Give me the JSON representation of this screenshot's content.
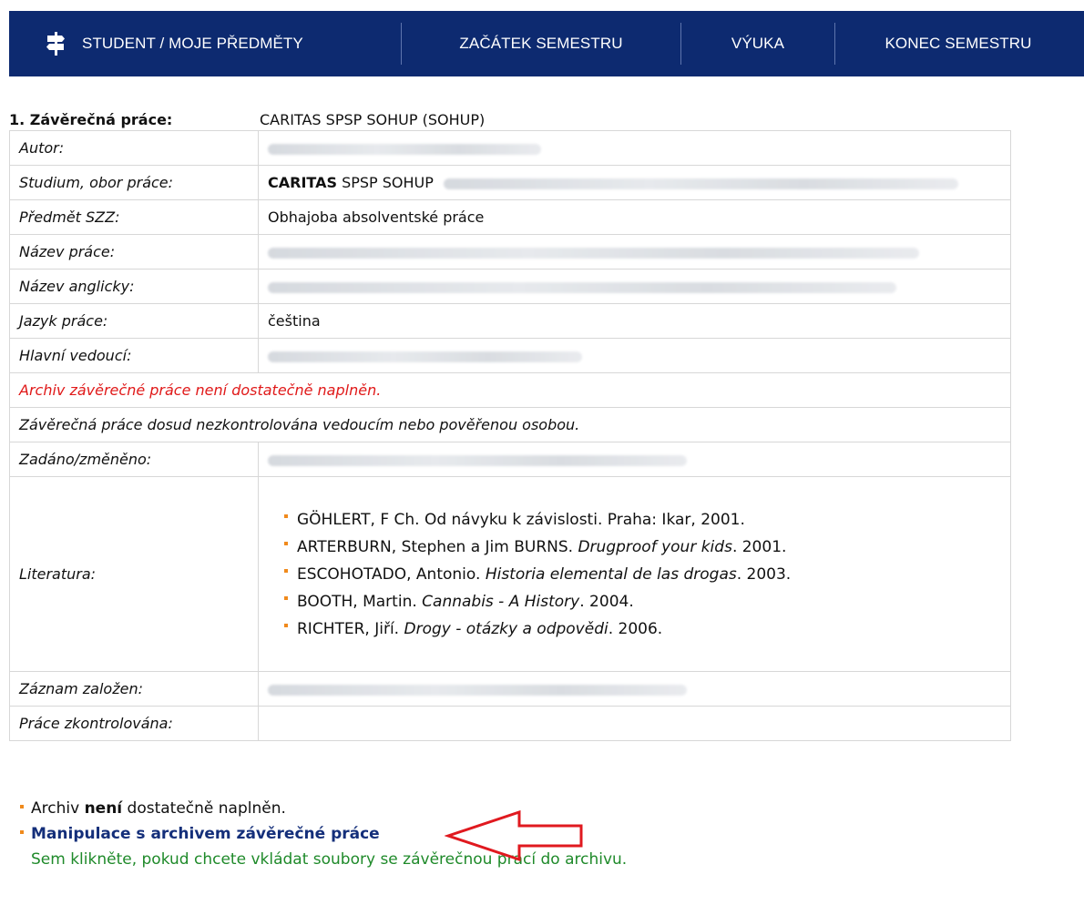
{
  "nav": {
    "items": [
      {
        "label": "STUDENT / MOJE PŘEDMĚTY",
        "icon": "signpost-icon"
      },
      {
        "label": "ZAČÁTEK SEMESTRU"
      },
      {
        "label": "VÝUKA"
      },
      {
        "label": "KONEC SEMESTRU"
      }
    ],
    "bg_color": "#0d2a70"
  },
  "thesis": {
    "number_label": "1. Závěrečná práce:",
    "program": "CARITAS SPSP SOHUP (SOHUP)"
  },
  "details": {
    "author_label": "Autor:",
    "study_label": "Studium, obor práce:",
    "study_bold": "CARITAS",
    "study_rest": "SPSP SOHUP",
    "subject_label": "Předmět SZZ:",
    "subject_value": "Obhajoba absolventské práce",
    "title_label": "Název práce:",
    "title_en_label": "Název anglicky:",
    "language_label": "Jazyk práce:",
    "language_value": "čeština",
    "supervisor_label": "Hlavní vedoucí:",
    "archive_warning": "Archiv závěrečné práce není dostatečně naplněn.",
    "control_note": "Závěrečná práce dosud nezkontrolována vedoucím nebo pověřenou osobou.",
    "assigned_label": "Zadáno/změněno:",
    "literature_label": "Literatura:",
    "created_label": "Záznam založen:",
    "checked_label": "Práce zkontrolována:"
  },
  "literature": [
    {
      "pre": "GÖHLERT, F Ch. Od návyku k závislosti. Praha: Ikar, 2001.",
      "title": "",
      "post": ""
    },
    {
      "pre": "ARTERBURN, Stephen a Jim BURNS. ",
      "title": "Drugproof your kids",
      "post": ". 2001."
    },
    {
      "pre": "ESCOHOTADO, Antonio. ",
      "title": "Historia elemental de las drogas",
      "post": ". 2003."
    },
    {
      "pre": "BOOTH, Martin. ",
      "title": "Cannabis - A History",
      "post": ". 2004."
    },
    {
      "pre": "RICHTER, Jiří. ",
      "title": "Drogy - otázky a odpovědi",
      "post": ". 2006."
    }
  ],
  "bottom": {
    "archive_pre": "Archiv ",
    "archive_bold": "není",
    "archive_post": " dostatečně naplněn.",
    "manipulate_link": "Manipulace s archivem závěrečné práce",
    "hint": "Sem klikněte, pokud chcete vkládat soubory se závěrečnou prací do archivu."
  },
  "colors": {
    "warning": "#e01919",
    "link": "#142f7a",
    "hint": "#1f8a2a",
    "bullet": "#f08a1c",
    "arrow": "#e0191f"
  }
}
